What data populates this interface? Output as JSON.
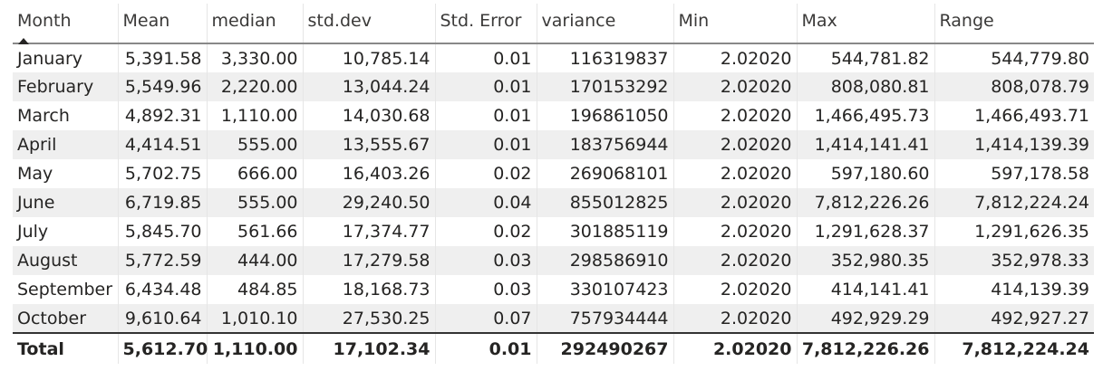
{
  "table": {
    "columns": [
      "Month",
      "Mean",
      "median",
      "std.dev",
      "Std. Error",
      "variance",
      "Min",
      "Max",
      "Range"
    ],
    "sort_indicator": "ascending",
    "rows": [
      [
        "January",
        "5,391.58",
        "3,330.00",
        "10,785.14",
        "0.01",
        "116319837",
        "2.02020",
        "544,781.82",
        "544,779.80"
      ],
      [
        "February",
        "5,549.96",
        "2,220.00",
        "13,044.24",
        "0.01",
        "170153292",
        "2.02020",
        "808,080.81",
        "808,078.79"
      ],
      [
        "March",
        "4,892.31",
        "1,110.00",
        "14,030.68",
        "0.01",
        "196861050",
        "2.02020",
        "1,466,495.73",
        "1,466,493.71"
      ],
      [
        "April",
        "4,414.51",
        "555.00",
        "13,555.67",
        "0.01",
        "183756944",
        "2.02020",
        "1,414,141.41",
        "1,414,139.39"
      ],
      [
        "May",
        "5,702.75",
        "666.00",
        "16,403.26",
        "0.02",
        "269068101",
        "2.02020",
        "597,180.60",
        "597,178.58"
      ],
      [
        "June",
        "6,719.85",
        "555.00",
        "29,240.50",
        "0.04",
        "855012825",
        "2.02020",
        "7,812,226.26",
        "7,812,224.24"
      ],
      [
        "July",
        "5,845.70",
        "561.66",
        "17,374.77",
        "0.02",
        "301885119",
        "2.02020",
        "1,291,628.37",
        "1,291,626.35"
      ],
      [
        "August",
        "5,772.59",
        "444.00",
        "17,279.58",
        "0.03",
        "298586910",
        "2.02020",
        "352,980.35",
        "352,978.33"
      ],
      [
        "September",
        "6,434.48",
        "484.85",
        "18,168.73",
        "0.03",
        "330107423",
        "2.02020",
        "414,141.41",
        "414,139.39"
      ],
      [
        "October",
        "9,610.64",
        "1,010.10",
        "27,530.25",
        "0.07",
        "757934444",
        "2.02020",
        "492,929.29",
        "492,927.27"
      ]
    ],
    "total": [
      "Total",
      "5,612.70",
      "1,110.00",
      "17,102.34",
      "0.01",
      "292490267",
      "2.02020",
      "7,812,226.26",
      "7,812,224.24"
    ]
  }
}
